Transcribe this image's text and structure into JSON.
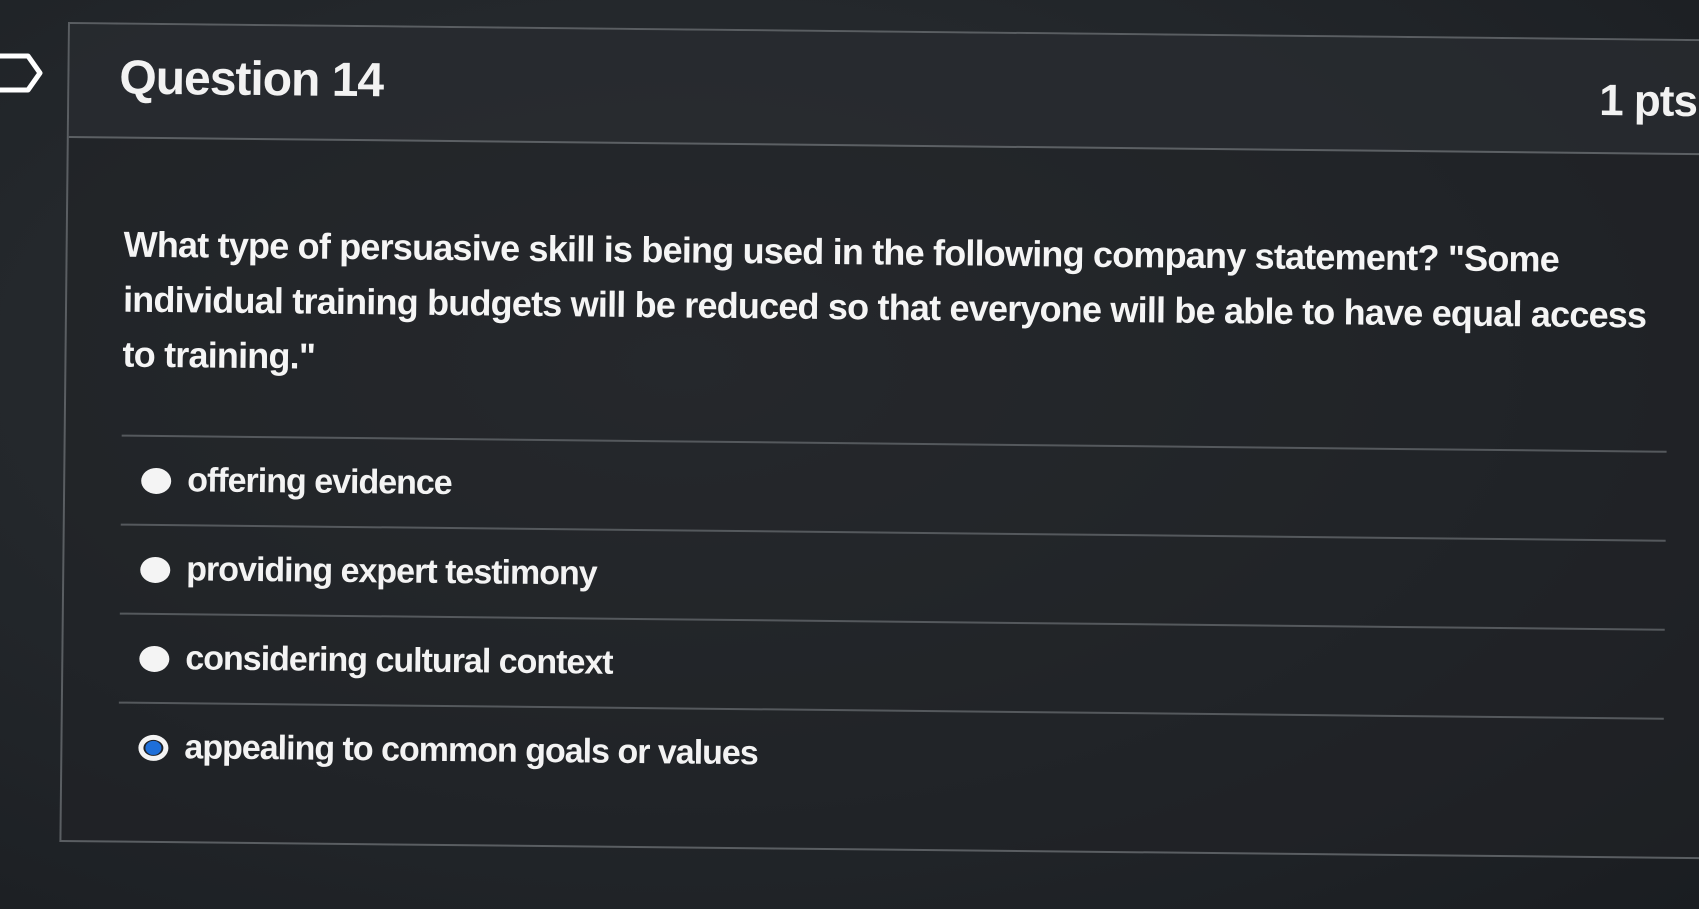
{
  "question": {
    "title": "Question 14",
    "points": "1 pts",
    "text": "What type of persuasive skill is being used in the following company statement? \"Some individual training budgets will be reduced so that everyone will be able to have equal access to training.\""
  },
  "answers": [
    {
      "label": "offering evidence",
      "selected": false
    },
    {
      "label": "providing expert testimony",
      "selected": false
    },
    {
      "label": "considering cultural context",
      "selected": false
    },
    {
      "label": "appealing to common goals or values",
      "selected": true
    }
  ],
  "colors": {
    "background": "#24282c",
    "text": "#f2f2f2",
    "selected_radio": "#1e6fd9"
  }
}
